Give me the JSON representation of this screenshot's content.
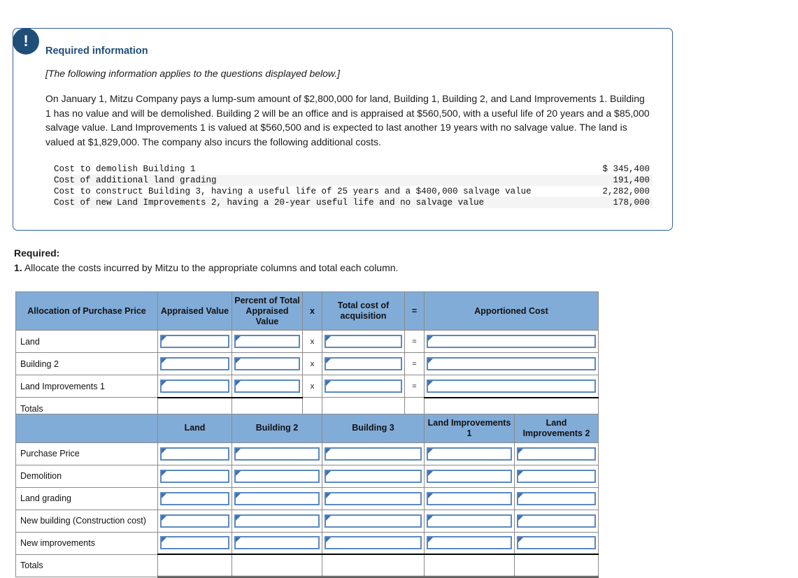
{
  "callout": {
    "icon": "exclamation-icon",
    "title": "Required information",
    "italic_note": "[The following information applies to the questions displayed below.]",
    "paragraph": "On January 1, Mitzu Company pays a lump-sum amount of $2,800,000 for land, Building 1, Building 2, and Land Improvements 1. Building 1 has no value and will be demolished. Building 2 will be an office and is appraised at $560,500, with a useful life of 20 years and a $85,000 salvage value. Land Improvements 1 is valued at $560,500 and is expected to last another 19 years with no salvage value. The land is valued at $1,829,000. The company also incurs the following additional costs.",
    "costs": [
      {
        "label": "Cost to demolish Building 1",
        "amount": "$ 345,400"
      },
      {
        "label": "Cost of additional land grading",
        "amount": "191,400"
      },
      {
        "label": "Cost to construct Building 3, having a useful life of 25 years and a $400,000 salvage value",
        "amount": "2,282,000"
      },
      {
        "label": "Cost of new Land Improvements 2, having a 20-year useful life and no salvage value",
        "amount": "178,000"
      }
    ]
  },
  "required": {
    "label": "Required:",
    "number": "1.",
    "text": "Allocate the costs incurred by Mitzu to the appropriate columns and total each column."
  },
  "table1": {
    "headers": {
      "row_label": "Allocation of Purchase Price",
      "appraised_value": "Appraised Value",
      "percent_total": "Percent of Total Appraised Value",
      "op_times": "x",
      "total_cost": "Total cost of acquisition",
      "op_equals": "=",
      "apportioned": "Apportioned Cost"
    },
    "rows": [
      {
        "label": "Land",
        "appraised_value": "",
        "percent_total": "",
        "op_times": "x",
        "total_cost": "",
        "op_equals": "=",
        "apportioned": ""
      },
      {
        "label": "Building 2",
        "appraised_value": "",
        "percent_total": "",
        "op_times": "x",
        "total_cost": "",
        "op_equals": "=",
        "apportioned": ""
      },
      {
        "label": "Land Improvements 1",
        "appraised_value": "",
        "percent_total": "",
        "op_times": "x",
        "total_cost": "",
        "op_equals": "=",
        "apportioned": ""
      }
    ],
    "totals": {
      "label": "Totals",
      "appraised_value": "",
      "percent_total": "",
      "total_cost": "",
      "apportioned": ""
    }
  },
  "table2": {
    "headers": {
      "row_label": "",
      "land": "Land",
      "building2": "Building 2",
      "building3": "Building 3",
      "land_improvements_1": "Land Improvements 1",
      "land_improvements_2": "Land Improvements 2"
    },
    "rows": [
      {
        "label": "Purchase Price",
        "land": "",
        "building2": "",
        "building3": "",
        "li1": "",
        "li2": ""
      },
      {
        "label": "Demolition",
        "land": "",
        "building2": "",
        "building3": "",
        "li1": "",
        "li2": ""
      },
      {
        "label": "Land grading",
        "land": "",
        "building2": "",
        "building3": "",
        "li1": "",
        "li2": ""
      },
      {
        "label": "New building (Construction cost)",
        "land": "",
        "building2": "",
        "building3": "",
        "li1": "",
        "li2": ""
      },
      {
        "label": "New improvements",
        "land": "",
        "building2": "",
        "building3": "",
        "li1": "",
        "li2": ""
      }
    ],
    "totals": {
      "label": "Totals",
      "land": "",
      "building2": "",
      "building3": "",
      "li1": "",
      "li2": ""
    }
  },
  "colors": {
    "header_blue": "#82ACD8",
    "callout_border": "#2f5d9e",
    "badge_navy": "#1f4e79",
    "field_border": "#5b89bf",
    "alt_row_gray": "#f4f4f4"
  }
}
